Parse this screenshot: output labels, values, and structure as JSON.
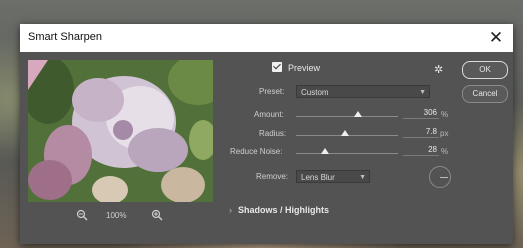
{
  "window": {
    "title": "Smart Sharpen",
    "close_glyph": "✕"
  },
  "preview": {
    "checkbox_label": "Preview",
    "checked": true,
    "zoom": "100%",
    "zoom_out_icon": "zoom-out-icon",
    "zoom_in_icon": "zoom-in-icon"
  },
  "settings_icon": "gear-icon",
  "preset": {
    "label": "Preset:",
    "value": "Custom"
  },
  "amount": {
    "label": "Amount:",
    "value": "306",
    "unit": "%",
    "fraction": 0.61
  },
  "radius": {
    "label": "Radius:",
    "value": "7.8",
    "unit": "px",
    "fraction": 0.48
  },
  "reduce_noise": {
    "label": "Reduce Noise:",
    "value": "28",
    "unit": "%",
    "fraction": 0.28
  },
  "remove": {
    "label": "Remove:",
    "value": "Lens Blur"
  },
  "buttons": {
    "ok": "OK",
    "cancel": "Cancel"
  },
  "section": {
    "label": "Shadows / Highlights",
    "chevron": "›"
  },
  "colors": {
    "dialog_bg": "#535353",
    "titlebar_bg": "#ffffff",
    "text": "#cfcfcf"
  }
}
